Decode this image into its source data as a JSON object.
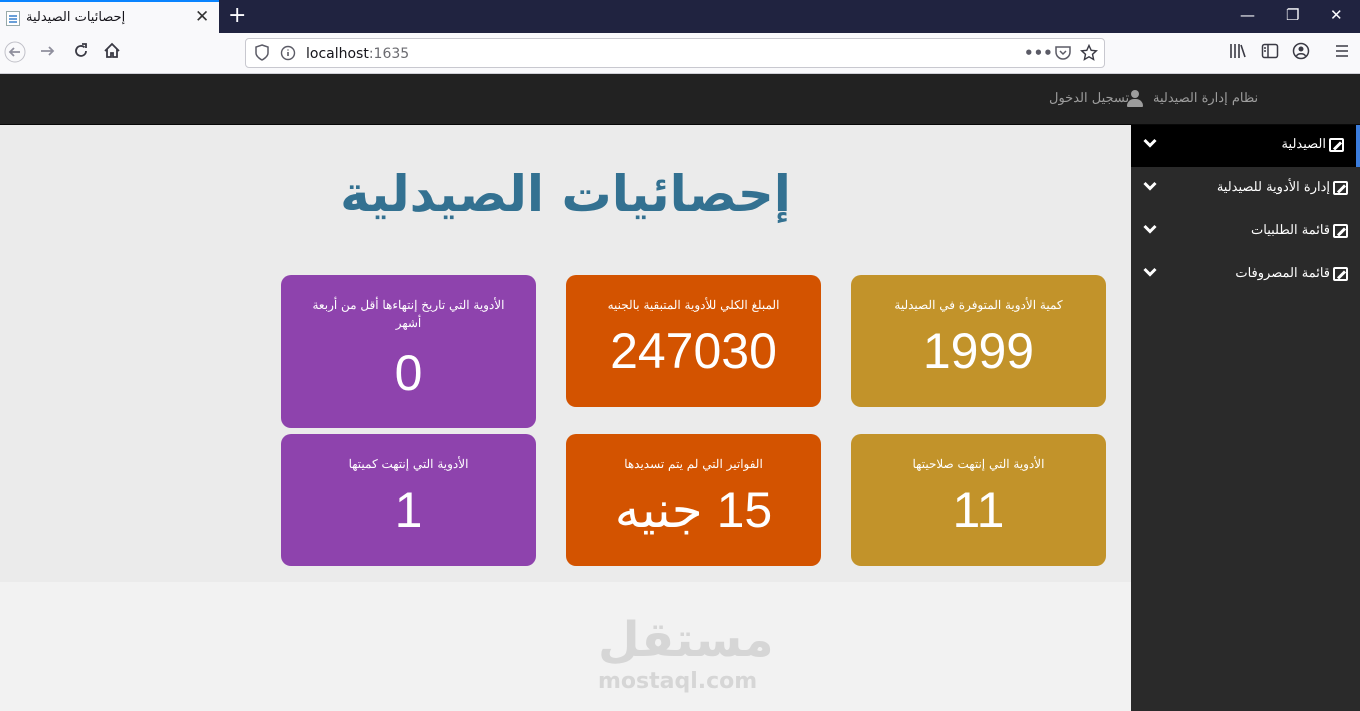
{
  "browser": {
    "tab_title": "إحصائيات الصيدلية",
    "tab_close": "✕",
    "new_tab": "+",
    "url_host": "localhost",
    "url_port": ":1635",
    "win_min": "—",
    "win_max": "❐",
    "win_close": "✕"
  },
  "header": {
    "brand": "نظام إدارة الصيدلية",
    "login": "تسجيل الدخول"
  },
  "sidebar": {
    "items": [
      {
        "label": "الصيدلية"
      },
      {
        "label": "إدارة الأدوية للصيدلية"
      },
      {
        "label": "قائمة الطلبيات"
      },
      {
        "label": "قائمة المصروفات"
      }
    ]
  },
  "main": {
    "title": "إحصائيات الصيدلية",
    "cards": [
      {
        "label": "كمية الأدوية المتوفرة في الصيدلية",
        "value": "1999",
        "color": "#c2932a"
      },
      {
        "label": "المبلغ الكلي للأدوية المتبقية بالجنيه",
        "value": "247030",
        "color": "#d35300"
      },
      {
        "label": "الأدوية التي تاريخ إنتهاءها أقل من أربعة أشهر",
        "value": "0",
        "color": "#8e43ad"
      },
      {
        "label": "الأدوية التي إنتهت صلاحيتها",
        "value": "11",
        "color": "#c2932a"
      },
      {
        "label": "الفواتير التي لم يتم تسديدها",
        "value": "15 جنيه",
        "color": "#d35300"
      },
      {
        "label": "الأدوية التي إنتهت كميتها",
        "value": "1",
        "color": "#8e43ad"
      }
    ]
  },
  "watermark": {
    "arabic": "مستقل",
    "latin": "mostaql.com"
  }
}
